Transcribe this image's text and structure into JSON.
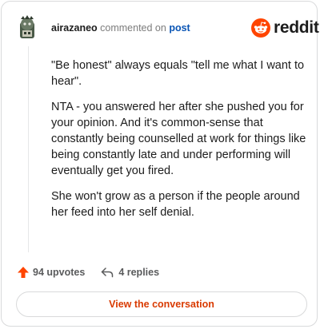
{
  "header": {
    "username": "airazaneo",
    "commented_on": "commented on",
    "post_link": "post",
    "brand": "reddit"
  },
  "comment": {
    "paragraphs": [
      "\"Be honest\" always equals \"tell me what I want to hear\".",
      "NTA - you answered her after she pushed you for your opinion. And it's common-sense that constantly being counselled at work for things like being constantly late and under performing will eventually get you fired.",
      "She won't grow as a person if the people around her feed into her self denial."
    ]
  },
  "actions": {
    "upvotes_label": "94 upvotes",
    "replies_label": "4 replies"
  },
  "cta": {
    "label": "View the conversation"
  },
  "colors": {
    "brand_orange": "#ff4500",
    "upvote_orange": "#ff4500",
    "cta_text": "#d93a00",
    "link_blue": "#0a55b5"
  },
  "icons": {
    "avatar": "user-avatar",
    "reddit_logo": "reddit-snoo-icon",
    "upvote": "upvote-arrow-icon",
    "reply": "reply-arrow-icon"
  }
}
